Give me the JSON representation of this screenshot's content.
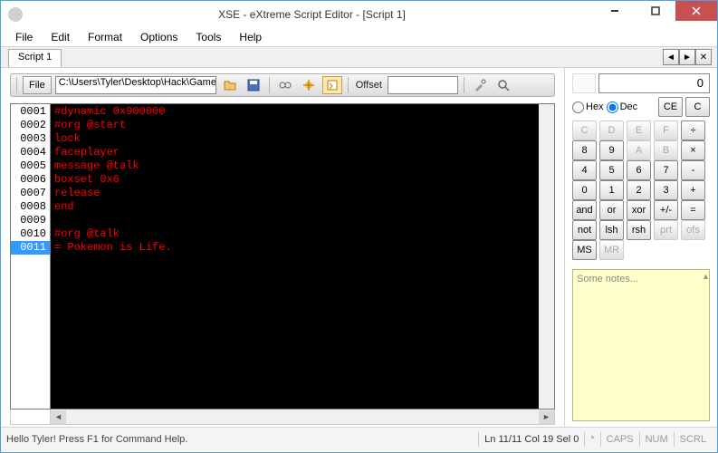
{
  "window": {
    "title": "XSE - eXtreme Script Editor - [Script 1]"
  },
  "menu": {
    "file": "File",
    "edit": "Edit",
    "format": "Format",
    "options": "Options",
    "tools": "Tools",
    "help": "Help"
  },
  "tabs": {
    "items": [
      "Script 1"
    ]
  },
  "toolbar": {
    "file_label": "File",
    "path": "C:\\Users\\Tyler\\Desktop\\Hack\\Game\\Poke",
    "offset_label": "Offset",
    "offset_value": ""
  },
  "editor": {
    "line_count": 11,
    "current_line": 11,
    "lines": [
      "#dynamic 0x900000",
      "#org @start",
      "lock",
      "faceplayer",
      "message @talk",
      "boxset 0x6",
      "release",
      "end",
      "",
      "#org @talk",
      "= Pokemon is Life."
    ]
  },
  "calc": {
    "display": "0",
    "hex": "Hex",
    "dec": "Dec",
    "ce": "CE",
    "c": "C",
    "btns": [
      [
        "C",
        "D",
        "E",
        "F",
        "÷"
      ],
      [
        "8",
        "9",
        "A",
        "B",
        "×"
      ],
      [
        "4",
        "5",
        "6",
        "7",
        "-"
      ],
      [
        "0",
        "1",
        "2",
        "3",
        "+"
      ],
      [
        "and",
        "or",
        "xor",
        "+/-",
        "="
      ],
      [
        "not",
        "lsh",
        "rsh",
        "prt",
        "ofs"
      ],
      [
        "MS",
        "MR",
        "",
        "",
        ""
      ]
    ],
    "disabled": [
      "C",
      "D",
      "E",
      "F",
      "A",
      "B",
      "prt",
      "ofs",
      "MR"
    ]
  },
  "notes": {
    "placeholder": "Some notes..."
  },
  "status": {
    "msg": "Hello Tyler! Press F1 for Command Help.",
    "pos": "Ln 11/11    Col 19    Sel 0",
    "star": "*",
    "caps": "CAPS",
    "num": "NUM",
    "scrl": "SCRL"
  }
}
